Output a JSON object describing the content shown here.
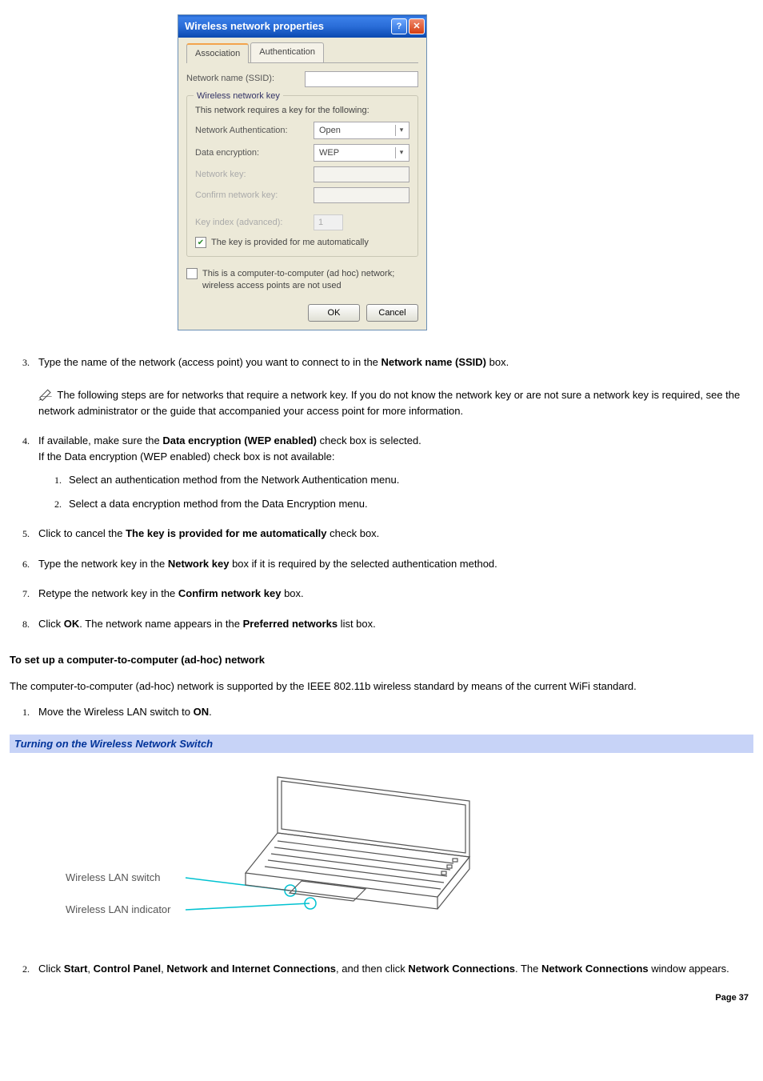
{
  "dialog": {
    "title": "Wireless network properties",
    "tabs": {
      "association": "Association",
      "authentication": "Authentication"
    },
    "ssid_label": "Network name (SSID):",
    "group_legend": "Wireless network key",
    "group_caption": "This network requires a key for the following:",
    "auth_label": "Network Authentication:",
    "auth_value": "Open",
    "enc_label": "Data encryption:",
    "enc_value": "WEP",
    "netkey_label": "Network key:",
    "confirm_label": "Confirm network key:",
    "keyindex_label": "Key index (advanced):",
    "keyindex_value": "1",
    "auto_key_label": "The key is provided for me automatically",
    "adhoc_label": "This is a computer-to-computer (ad hoc) network; wireless access points are not used",
    "ok": "OK",
    "cancel": "Cancel"
  },
  "steps_a": {
    "s3_pre": "Type the name of the network (access point) you want to connect to in the ",
    "s3_bold": "Network name (SSID)",
    "s3_post": " box.",
    "note": " The following steps are for networks that require a network key. If you do not know the network key or are not sure a network key is required, see the network administrator or the guide that accompanied your access point for more information.",
    "s4_pre": "If available, make sure the ",
    "s4_bold": "Data encryption (WEP enabled)",
    "s4_mid": " check box is selected.",
    "s4_line2": "If the Data encryption (WEP enabled) check box is not available:",
    "s4_sub1": "Select an authentication method from the Network Authentication menu.",
    "s4_sub2": "Select a data encryption method from the Data Encryption menu.",
    "s5_pre": "Click to cancel the ",
    "s5_bold": "The key is provided for me automatically",
    "s5_post": " check box.",
    "s6_pre": "Type the network key in the ",
    "s6_bold": "Network key",
    "s6_post": " box if it is required by the selected authentication method.",
    "s7_pre": "Retype the network key in the ",
    "s7_bold": "Confirm network key",
    "s7_post": " box.",
    "s8_pre": "Click ",
    "s8_b1": "OK",
    "s8_mid": ". The network name appears in the ",
    "s8_b2": "Preferred networks",
    "s8_post": " list box."
  },
  "adhoc": {
    "heading": "To set up a computer-to-computer (ad-hoc) network",
    "intro": "The computer-to-computer (ad-hoc) network is supported by the IEEE 802.11b wireless standard by means of the current WiFi standard.",
    "s1_pre": "Move the Wireless LAN switch to ",
    "s1_bold": "ON",
    "s1_post": ".",
    "banner": "Turning on the Wireless Network Switch",
    "label_switch": "Wireless LAN switch",
    "label_indicator": "Wireless LAN indicator",
    "s2_pre": "Click ",
    "s2_b1": "Start",
    "s2_c1": ", ",
    "s2_b2": "Control Panel",
    "s2_c2": ", ",
    "s2_b3": "Network and Internet Connections",
    "s2_c3": ", and then click ",
    "s2_b4": "Network Connections",
    "s2_c4": ". The ",
    "s2_b5": "Network Connections",
    "s2_post": " window appears."
  },
  "footer": "Page 37"
}
